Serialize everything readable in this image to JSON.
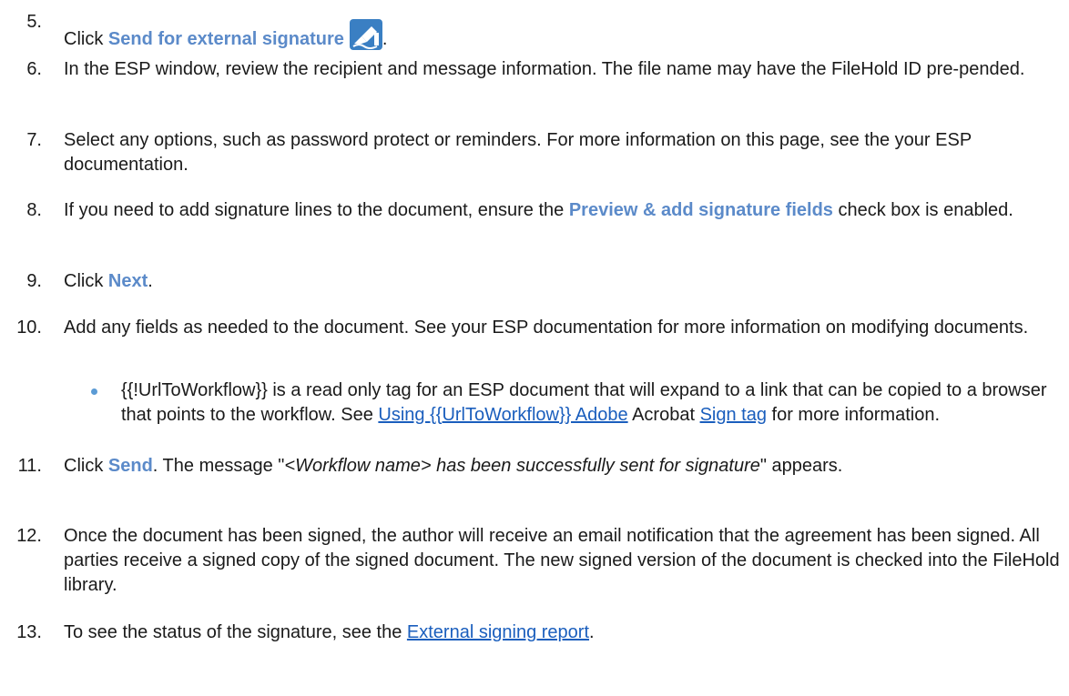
{
  "steps": [
    {
      "number": "5.",
      "text_before": "Click ",
      "ui_label": "Send for external signature",
      "icon": "send-for-signature-icon",
      "text_after": "."
    },
    {
      "number": "6.",
      "text": "In the ESP window, review the recipient and message information. The file name may have the FileHold ID pre-pended."
    },
    {
      "number": "7.",
      "text": "Select any options, such as password protect or reminders. For more information on this page, see the your ESP documentation."
    },
    {
      "number": "8.",
      "text_before": "If you need to add signature lines to the document, ensure the ",
      "ui_label": "Preview & add signature fields",
      "text_after": " check box is enabled."
    },
    {
      "number": "9.",
      "text_before": "Click ",
      "ui_label": "Next",
      "text_after": "."
    },
    {
      "number": "10.",
      "text": "Add any fields as needed to the document. See your ESP documentation for more information on modifying documents."
    },
    {
      "number": "11.",
      "text_before": "Click ",
      "ui_label": "Send",
      "text_mid": ". The message \"",
      "italic": "<Workflow name> has been successfully sent for signature",
      "text_after": "\" appears."
    },
    {
      "number": "12.",
      "text": "Once the document has been signed, the author will receive an email notification that the agreement has been signed. All parties receive a signed copy of the signed document. The new signed version of the document is checked into the FileHold library."
    },
    {
      "number": "13.",
      "text_before": "To see the status of the signature, see the ",
      "link": "External signing report",
      "text_after": "."
    }
  ],
  "bullet": {
    "text_before": "{{!UrlToWorkflow}} is a read only tag for an ESP document that will expand to a link that can be copied to a browser that points to the workflow. See ",
    "link1": "Using {{UrlToWorkflow}} Adobe",
    "text_mid": " Acrobat ",
    "link2": "Sign tag",
    "text_after": " for more information."
  },
  "colors": {
    "ui_label": "#5b8ac9",
    "link": "#1a5ebd",
    "bullet": "#5b9bd5",
    "icon_bg": "#3a7fc3"
  }
}
